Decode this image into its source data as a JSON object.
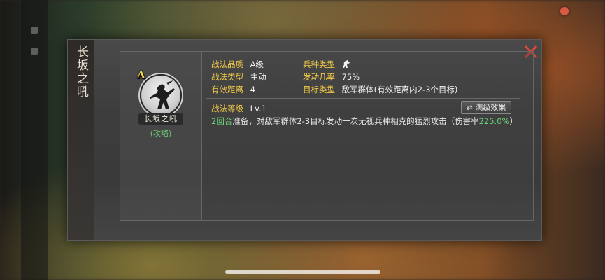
{
  "dialog": {
    "title": "长坂之吼"
  },
  "card": {
    "grade_letter": "A",
    "skill_name": "长坂之吼",
    "category_tag": "(攻略)"
  },
  "details": {
    "quality_label": "战法品质",
    "quality_value": "A级",
    "type_label": "战法类型",
    "type_value": "主动",
    "range_label": "有效距离",
    "range_value": "4",
    "troop_label": "兵种类型",
    "troop_icon": "cavalry-horse-icon",
    "rate_label": "发动几率",
    "rate_value": "75%",
    "target_label": "目标类型",
    "target_value": "敌军群体(有效距离内2-3个目标)",
    "level_label": "战法等级",
    "level_value": "Lv.1",
    "max_level_button": "满级效果",
    "desc_rounds": "2回合",
    "desc_main": "准备，对敌军群体2-3目标发动一次无视兵种相克的猛烈攻击（伤害率",
    "desc_rate": "225.0%",
    "desc_end": "）"
  },
  "colors": {
    "label_gold": "#f0c848",
    "highlight_green": "#6cd27a",
    "close_red": "#d8483a"
  }
}
